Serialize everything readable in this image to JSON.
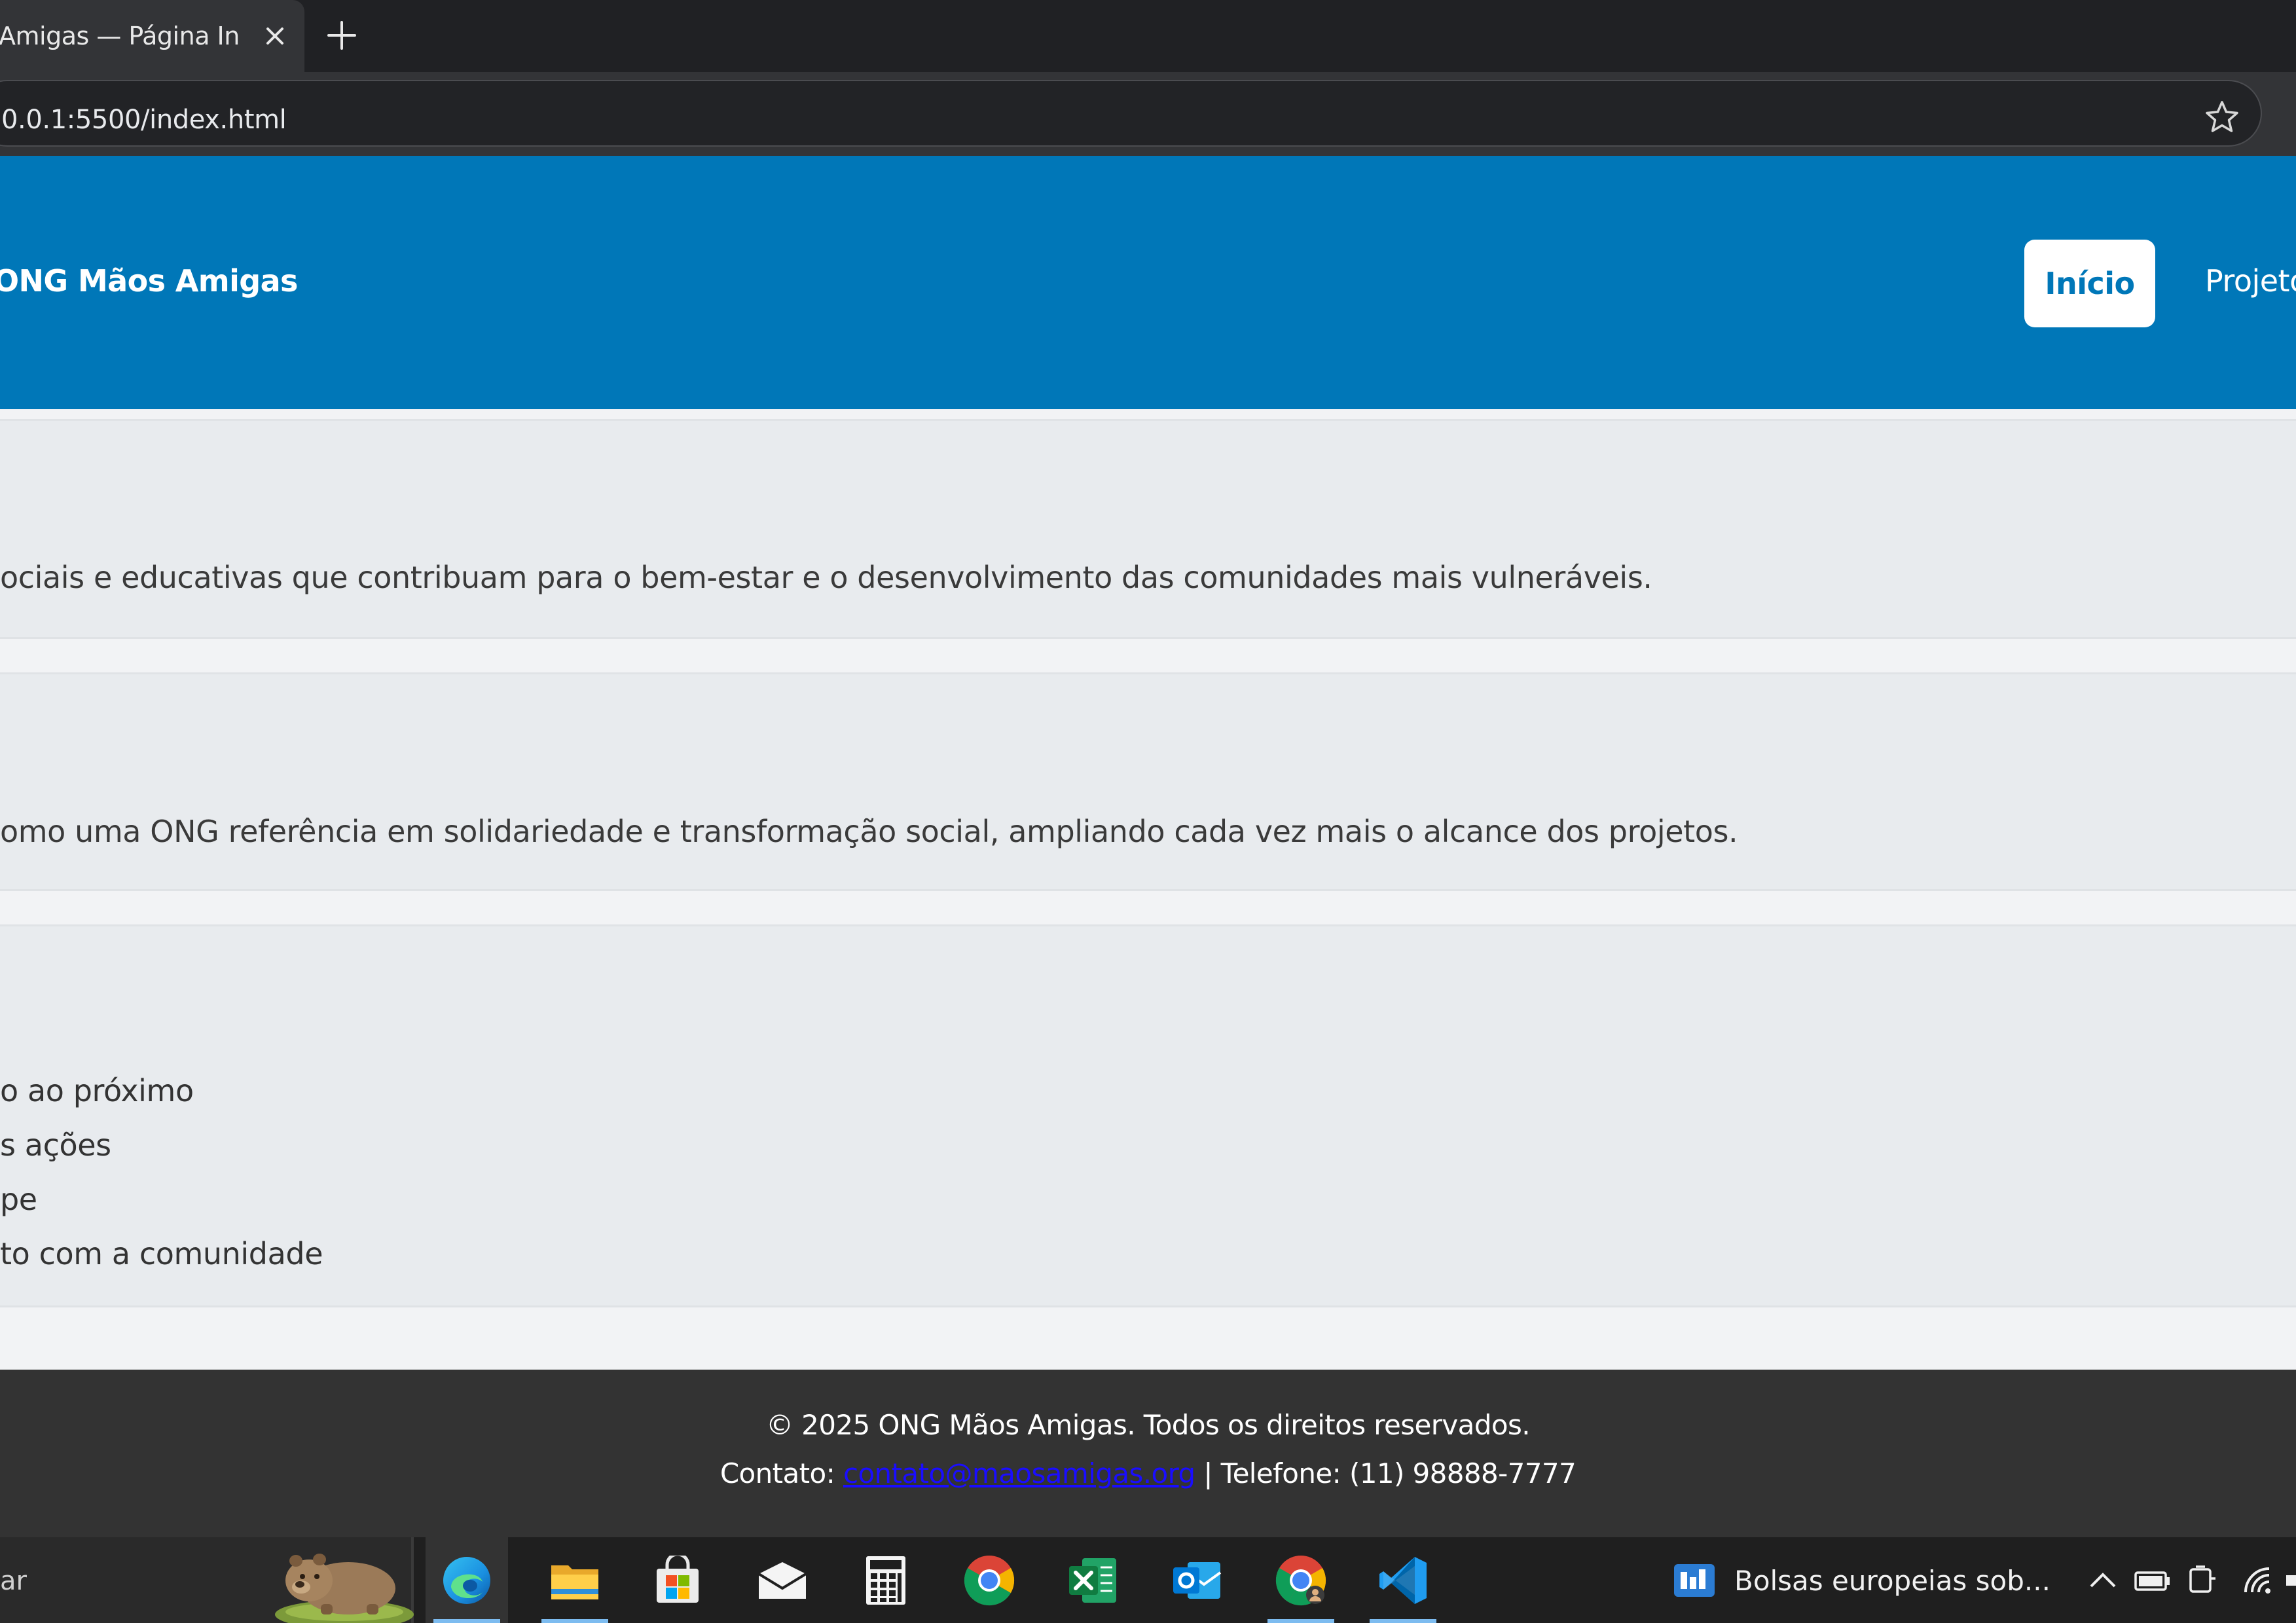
{
  "browser": {
    "tab_title": "Amigas — Página Inic",
    "url": "0.0.1:5500/index.html"
  },
  "site": {
    "brand": "ONG Mãos Amigas",
    "nav": {
      "home": "Início",
      "projects": "Projeto"
    }
  },
  "sections": {
    "missao_text": "ociais e educativas que contribuam para o bem-estar e o desenvolvimento das comunidades mais vulneráveis.",
    "visao_text": "omo uma ONG referência em solidariedade e transformação social, ampliando cada vez mais o alcance dos projetos.",
    "valores": [
      "o ao próximo",
      "s ações",
      "pe",
      "to com a comunidade"
    ]
  },
  "footer": {
    "copyright": "© 2025 ONG Mãos Amigas. Todos os direitos reservados.",
    "contact_label": "Contato: ",
    "email": "contato@maosamigas.org",
    "phone": " | Telefone: (11) 98888-7777"
  },
  "taskbar": {
    "search_text": "ar",
    "news_text": "Bolsas europeias sob...",
    "apps": [
      "edge-icon",
      "file-explorer-icon",
      "store-icon",
      "mail-icon",
      "calculator-icon",
      "chrome-icon",
      "excel-icon",
      "outlook-icon",
      "chrome-profile-icon",
      "vscode-icon"
    ]
  },
  "colors": {
    "header": "#0077b8",
    "footer": "#333333",
    "section": "#e8ebee",
    "link": "#1a0dff"
  }
}
